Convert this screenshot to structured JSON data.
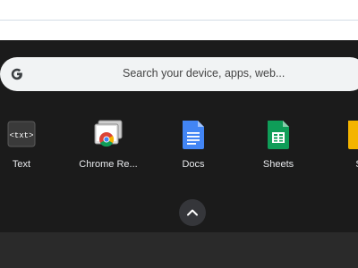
{
  "search": {
    "placeholder": "Search your device, apps, web..."
  },
  "apps": [
    {
      "label": "Text"
    },
    {
      "label": "Chrome Re..."
    },
    {
      "label": "Docs"
    },
    {
      "label": "Sheets"
    },
    {
      "label": "S"
    }
  ],
  "icons": {
    "search_logo": "google-g-icon",
    "text_app": "text-app-icon",
    "chrome_app": "chrome-remote-desktop-icon",
    "docs_app": "docs-icon",
    "sheets_app": "sheets-icon",
    "slides_app": "slides-icon",
    "expand": "chevron-up-icon"
  },
  "colors": {
    "launcher_bg": "#1b1b1b",
    "search_bg": "#f1f3f4",
    "docs_blue": "#4285f4",
    "sheets_green": "#0f9d58",
    "slides_yellow": "#f4b400"
  }
}
